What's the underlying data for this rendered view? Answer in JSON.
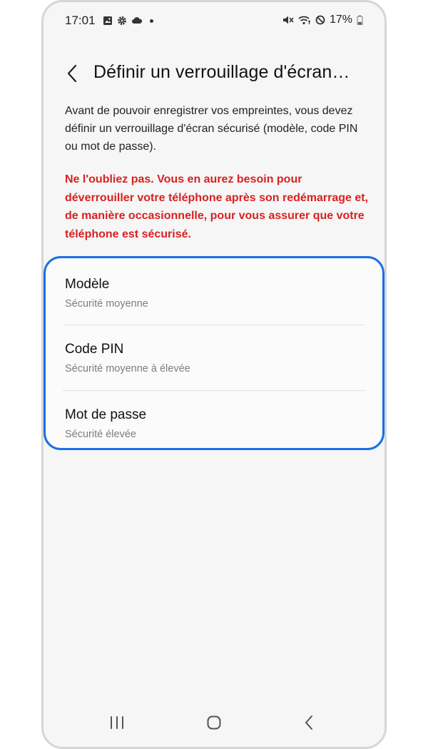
{
  "status_bar": {
    "time": "17:01",
    "battery": "17%"
  },
  "header": {
    "title": "Définir un verrouillage d'écran…"
  },
  "description": "Avant de pouvoir enregistrer vos empreintes, vous devez définir un verrouillage d'écran sécurisé (modèle, code PIN ou mot de passe).",
  "warning": "Ne l'oubliez pas. Vous en aurez besoin pour déverrouiller votre téléphone après son redémarrage et, de manière occasionnelle, pour vous assurer que votre téléphone est sécurisé.",
  "options": [
    {
      "title": "Modèle",
      "subtitle": "Sécurité moyenne"
    },
    {
      "title": "Code PIN",
      "subtitle": "Sécurité moyenne à élevée"
    },
    {
      "title": "Mot de passe",
      "subtitle": "Sécurité élevée"
    }
  ],
  "colors": {
    "highlight_border": "#1a6fe6",
    "warning_text": "#d92121"
  },
  "icons": {
    "status_left": [
      "image-icon",
      "gear-icon",
      "cloud-icon"
    ],
    "status_right": [
      "mute-icon",
      "wifi-icon",
      "do-not-disturb-icon",
      "battery-icon"
    ],
    "nav": [
      "recent-apps-icon",
      "home-icon",
      "back-icon"
    ]
  }
}
